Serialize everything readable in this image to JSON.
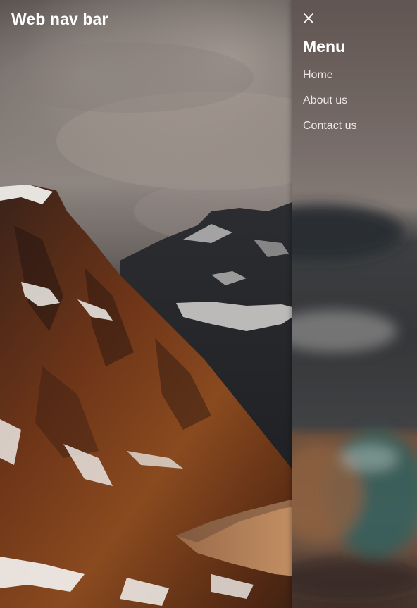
{
  "header": {
    "title": "Web nav bar"
  },
  "nav_drawer": {
    "close_icon": "close-icon",
    "heading": "Menu",
    "items": [
      {
        "label": "Home"
      },
      {
        "label": "About us"
      },
      {
        "label": "Contact us"
      }
    ]
  },
  "hero": {
    "image": "snowy-mountain-landscape-photo"
  },
  "colors": {
    "title_text": "#ffffff",
    "menu_text": "#ece8e4",
    "sky": "#8a807a",
    "rock": "#7a3a18",
    "snow": "#e8e4e0"
  }
}
